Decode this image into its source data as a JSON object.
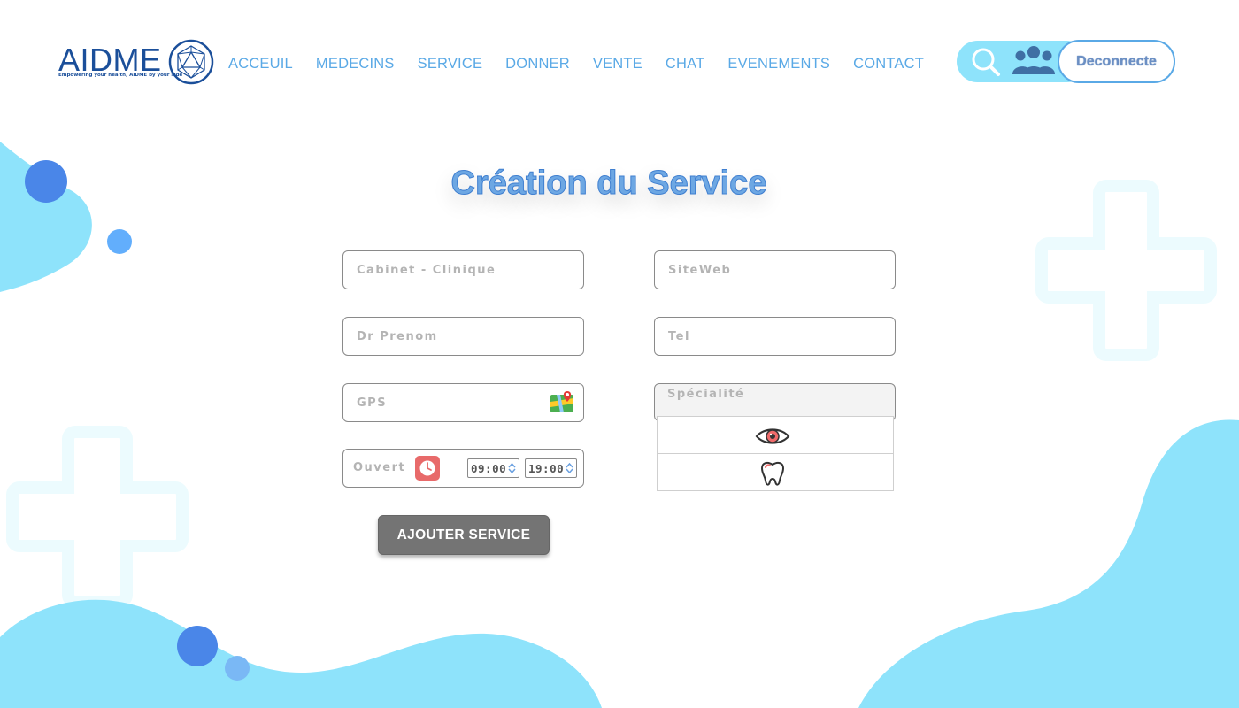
{
  "brand": {
    "name": "AIDME",
    "tagline": "Empowering your health, AIDME by your side",
    "color": "#1b4f9a"
  },
  "nav": {
    "items": [
      {
        "label": "ACCEUIL"
      },
      {
        "label": "MEDECINS"
      },
      {
        "label": "SERVICE"
      },
      {
        "label": "DONNER"
      },
      {
        "label": "VENTE"
      },
      {
        "label": "CHAT"
      },
      {
        "label": "EVENEMENTS"
      },
      {
        "label": "CONTACT"
      }
    ],
    "color": "#5aa9e6"
  },
  "header_actions": {
    "search_icon": "search-icon",
    "users_icon": "users-icon",
    "logout_label": "Deconnecte"
  },
  "page": {
    "title": "Création du Service"
  },
  "form": {
    "cabinet_placeholder": "Cabinet - Clinique",
    "siteweb_placeholder": "SiteWeb",
    "prenom_placeholder": "Dr Prenom",
    "tel_placeholder": "Tel",
    "gps_placeholder": "GPS",
    "specialite_label": "Spécialité",
    "specialite_options": [
      {
        "icon": "eye-icon"
      },
      {
        "icon": "tooth-icon"
      }
    ],
    "open_label": "Ouvert",
    "open_time": "09:00",
    "close_time": "19:00",
    "submit_label": "AJOUTER SERVICE"
  },
  "colors": {
    "accent_cyan": "#8ee3fb",
    "accent_blue": "#4a86e8",
    "title_color": "#6da7e3",
    "button_gray": "#747474"
  }
}
